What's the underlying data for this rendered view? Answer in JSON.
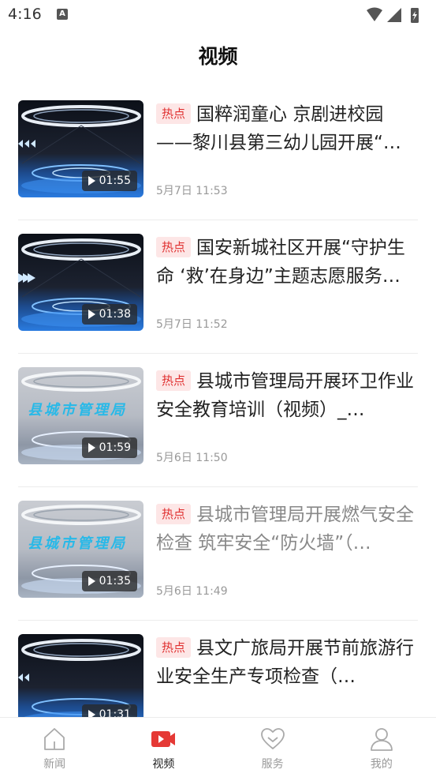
{
  "status": {
    "time": "4:16",
    "a_badge": "A"
  },
  "page": {
    "title": "视频"
  },
  "colors": {
    "accent": "#e03030",
    "hot_bg": "#fde6e6"
  },
  "videos": [
    {
      "hot": "热点",
      "title": "国粹润童心 京剧进校园——黎川县第三幼儿园开展“…",
      "date": "5月7日 11:53",
      "duration": "01:55",
      "caption": ""
    },
    {
      "hot": "热点",
      "title": "国安新城社区开展“守护生命 ‘救’在身边”主题志愿服务…",
      "date": "5月7日 11:52",
      "duration": "01:38",
      "caption": ""
    },
    {
      "hot": "热点",
      "title": "县城市管理局开展环卫作业安全教育培训（视频）_…",
      "date": "5月6日 11:50",
      "duration": "01:59",
      "caption": "县城市管理局"
    },
    {
      "hot": "热点",
      "title": "县城市管理局开展燃气安全检查 筑牢安全“防火墙”（…",
      "date": "5月6日 11:49",
      "duration": "01:35",
      "caption": "县城市管理局"
    },
    {
      "hot": "热点",
      "title": "县文广旅局开展节前旅游行业安全生产专项检查（…",
      "date": "",
      "duration": "01:31",
      "caption": ""
    }
  ],
  "tabbar": {
    "items": [
      {
        "label": "新闻",
        "icon": "home-icon"
      },
      {
        "label": "视频",
        "icon": "video-icon"
      },
      {
        "label": "服务",
        "icon": "heart-icon"
      },
      {
        "label": "我的",
        "icon": "user-icon"
      }
    ]
  }
}
